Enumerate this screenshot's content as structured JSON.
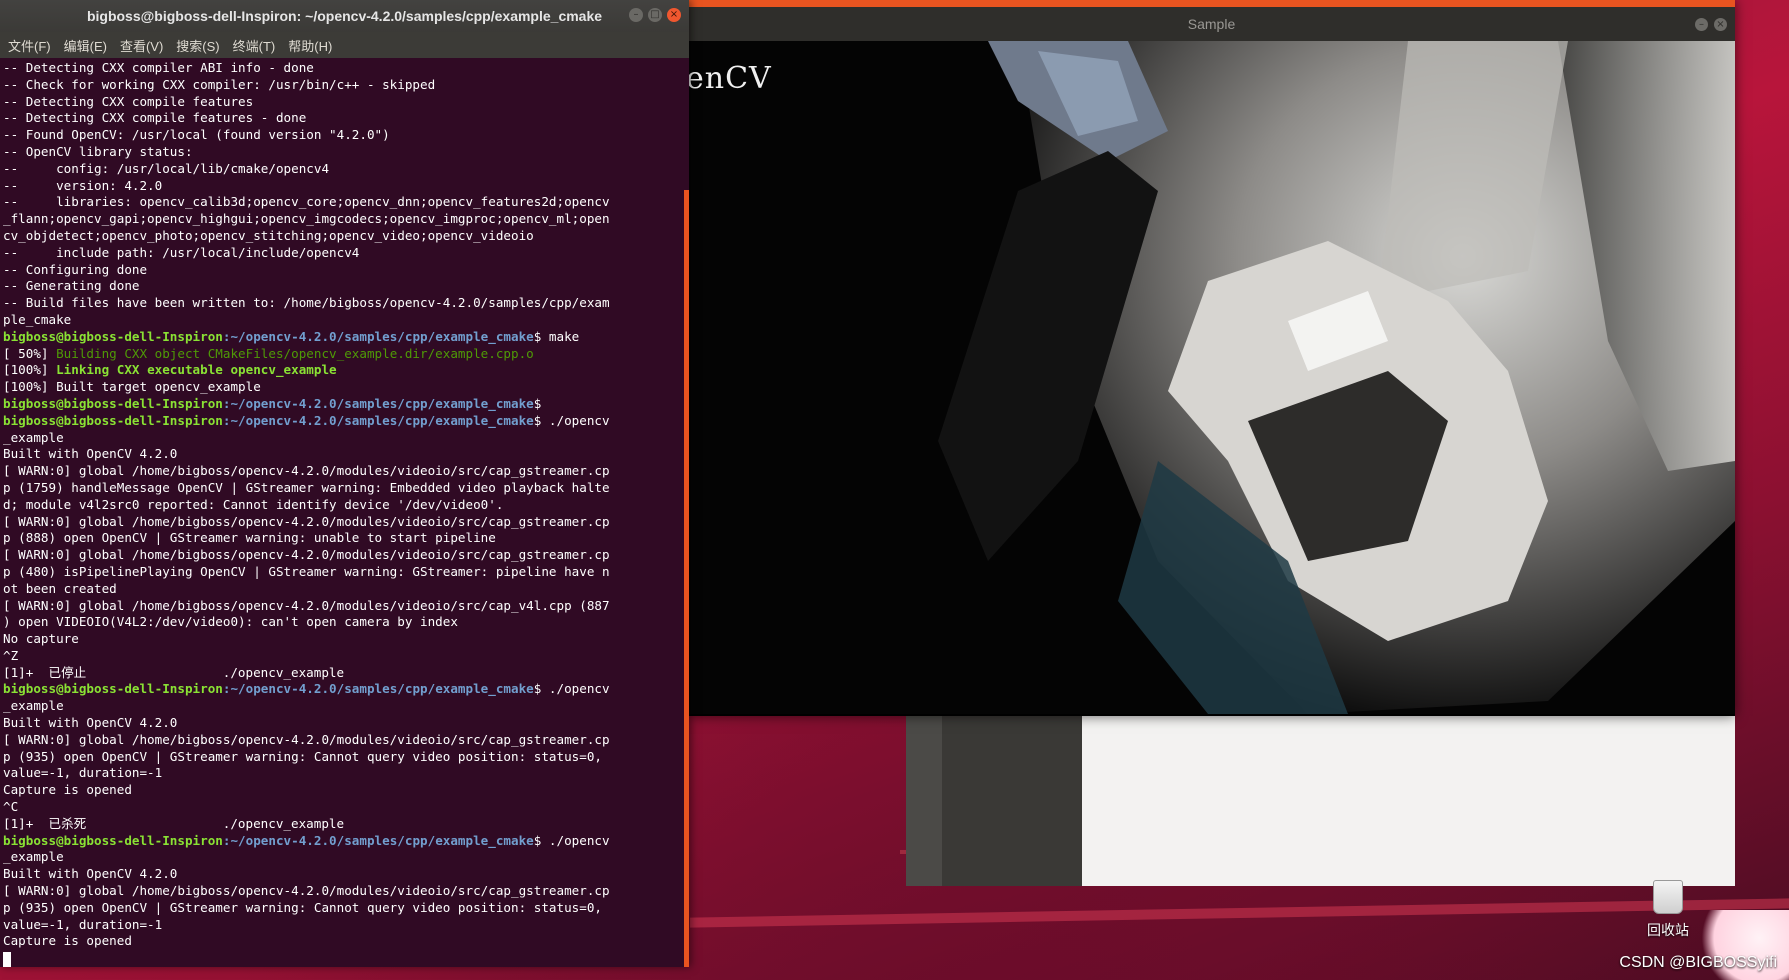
{
  "desktop": {
    "trash_label": "回收站",
    "watermark": "CSDN @BIGBOSSyifi"
  },
  "sample_window": {
    "title": "Sample",
    "overlay_text": "enCV"
  },
  "terminal": {
    "title": "bigboss@bigboss-dell-Inspiron: ~/opencv-4.2.0/samples/cpp/example_cmake",
    "menu": [
      "文件(F)",
      "编辑(E)",
      "查看(V)",
      "搜索(S)",
      "终端(T)",
      "帮助(H)"
    ],
    "lines": [
      {
        "t": "-- Detecting CXX compiler ABI info - done"
      },
      {
        "t": "-- Check for working CXX compiler: /usr/bin/c++ - skipped"
      },
      {
        "t": "-- Detecting CXX compile features"
      },
      {
        "t": "-- Detecting CXX compile features - done"
      },
      {
        "t": "-- Found OpenCV: /usr/local (found version \"4.2.0\")"
      },
      {
        "t": "-- OpenCV library status:"
      },
      {
        "t": "--     config: /usr/local/lib/cmake/opencv4"
      },
      {
        "t": "--     version: 4.2.0"
      },
      {
        "t": "--     libraries: opencv_calib3d;opencv_core;opencv_dnn;opencv_features2d;opencv"
      },
      {
        "t": "_flann;opencv_gapi;opencv_highgui;opencv_imgcodecs;opencv_imgproc;opencv_ml;open"
      },
      {
        "t": "cv_objdetect;opencv_photo;opencv_stitching;opencv_video;opencv_videoio"
      },
      {
        "t": "--     include path: /usr/local/include/opencv4"
      },
      {
        "t": "-- Configuring done"
      },
      {
        "t": "-- Generating done"
      },
      {
        "t": "-- Build files have been written to: /home/bigboss/opencv-4.2.0/samples/cpp/exam"
      },
      {
        "t": "ple_cmake"
      },
      {
        "p": true,
        "t": " make"
      },
      {
        "t": "[ 50%] ",
        "g": "Building CXX object CMakeFiles/opencv_example.dir/example.cpp.o"
      },
      {
        "t": "[100%] ",
        "lg": "Linking CXX executable opencv_example"
      },
      {
        "t": "[100%] Built target opencv_example"
      },
      {
        "p": true,
        "t": ""
      },
      {
        "p": true,
        "t": " ./opencv"
      },
      {
        "t": "_example"
      },
      {
        "t": "Built with OpenCV 4.2.0"
      },
      {
        "t": "[ WARN:0] global /home/bigboss/opencv-4.2.0/modules/videoio/src/cap_gstreamer.cp"
      },
      {
        "t": "p (1759) handleMessage OpenCV | GStreamer warning: Embedded video playback halte"
      },
      {
        "t": "d; module v4l2src0 reported: Cannot identify device '/dev/video0'."
      },
      {
        "t": "[ WARN:0] global /home/bigboss/opencv-4.2.0/modules/videoio/src/cap_gstreamer.cp"
      },
      {
        "t": "p (888) open OpenCV | GStreamer warning: unable to start pipeline"
      },
      {
        "t": "[ WARN:0] global /home/bigboss/opencv-4.2.0/modules/videoio/src/cap_gstreamer.cp"
      },
      {
        "t": "p (480) isPipelinePlaying OpenCV | GStreamer warning: GStreamer: pipeline have n"
      },
      {
        "t": "ot been created"
      },
      {
        "t": "[ WARN:0] global /home/bigboss/opencv-4.2.0/modules/videoio/src/cap_v4l.cpp (887"
      },
      {
        "t": ") open VIDEOIO(V4L2:/dev/video0): can't open camera by index"
      },
      {
        "t": "No capture"
      },
      {
        "t": "^Z"
      },
      {
        "t": "[1]+  已停止                  ./opencv_example"
      },
      {
        "p": true,
        "t": " ./opencv"
      },
      {
        "t": "_example"
      },
      {
        "t": "Built with OpenCV 4.2.0"
      },
      {
        "t": "[ WARN:0] global /home/bigboss/opencv-4.2.0/modules/videoio/src/cap_gstreamer.cp"
      },
      {
        "t": "p (935) open OpenCV | GStreamer warning: Cannot query video position: status=0,"
      },
      {
        "t": "value=-1, duration=-1"
      },
      {
        "t": "Capture is opened"
      },
      {
        "t": "^C"
      },
      {
        "t": "[1]+  已杀死                  ./opencv_example"
      },
      {
        "p": true,
        "t": " ./opencv"
      },
      {
        "t": "_example"
      },
      {
        "t": "Built with OpenCV 4.2.0"
      },
      {
        "t": "[ WARN:0] global /home/bigboss/opencv-4.2.0/modules/videoio/src/cap_gstreamer.cp"
      },
      {
        "t": "p (935) open OpenCV | GStreamer warning: Cannot query video position: status=0,"
      },
      {
        "t": "value=-1, duration=-1"
      },
      {
        "t": "Capture is opened"
      },
      {
        "cursor": true,
        "t": ""
      }
    ],
    "prompt_user": "bigboss@bigboss-dell-Inspiron",
    "prompt_path": ":~/opencv-4.2.0/samples/cpp/example_cmake",
    "prompt_symbol": "$"
  },
  "colors": {
    "terminal_bg": "#300a24",
    "accent": "#e95420",
    "prompt_user": "#8ae234",
    "prompt_path": "#729fcf"
  }
}
